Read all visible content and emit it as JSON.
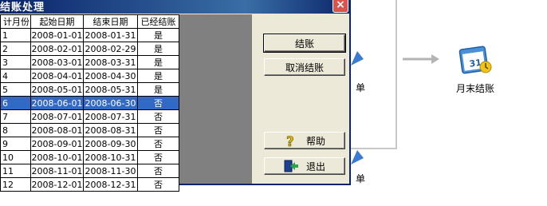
{
  "dialog": {
    "title": "结账处理",
    "close_symbol": "×"
  },
  "grid": {
    "headers": [
      "计月份",
      "起始日期",
      "结束日期",
      "已经结账"
    ],
    "rows": [
      [
        "1",
        "2008-01-01",
        "2008-01-31",
        "是"
      ],
      [
        "2",
        "2008-02-01",
        "2008-02-29",
        "是"
      ],
      [
        "3",
        "2008-03-01",
        "2008-03-31",
        "是"
      ],
      [
        "4",
        "2008-04-01",
        "2008-04-30",
        "是"
      ],
      [
        "5",
        "2008-05-01",
        "2008-05-31",
        "是"
      ],
      [
        "6",
        "2008-06-01",
        "2008-06-30",
        "否"
      ],
      [
        "7",
        "2008-07-01",
        "2008-07-31",
        "否"
      ],
      [
        "8",
        "2008-08-01",
        "2008-08-31",
        "否"
      ],
      [
        "9",
        "2008-09-01",
        "2008-09-30",
        "否"
      ],
      [
        "10",
        "2008-10-01",
        "2008-10-31",
        "否"
      ],
      [
        "11",
        "2008-11-01",
        "2008-11-30",
        "否"
      ],
      [
        "12",
        "2008-12-01",
        "2008-12-31",
        "否"
      ]
    ],
    "selected_row": 5
  },
  "buttons": {
    "settle": "结账",
    "cancel_settle": "取消结账",
    "help": "帮助",
    "exit": "退出"
  },
  "background": {
    "month_end_label": "月末结账",
    "partial_label_1": "单",
    "partial_label_2": "单",
    "icons": [
      "calendar-icon",
      "document-icon"
    ]
  },
  "colors": {
    "title_bar": "#0a246a",
    "selection": "#3169c6",
    "dialog_face": "#ece9d8",
    "grid_backdrop": "#808080"
  }
}
